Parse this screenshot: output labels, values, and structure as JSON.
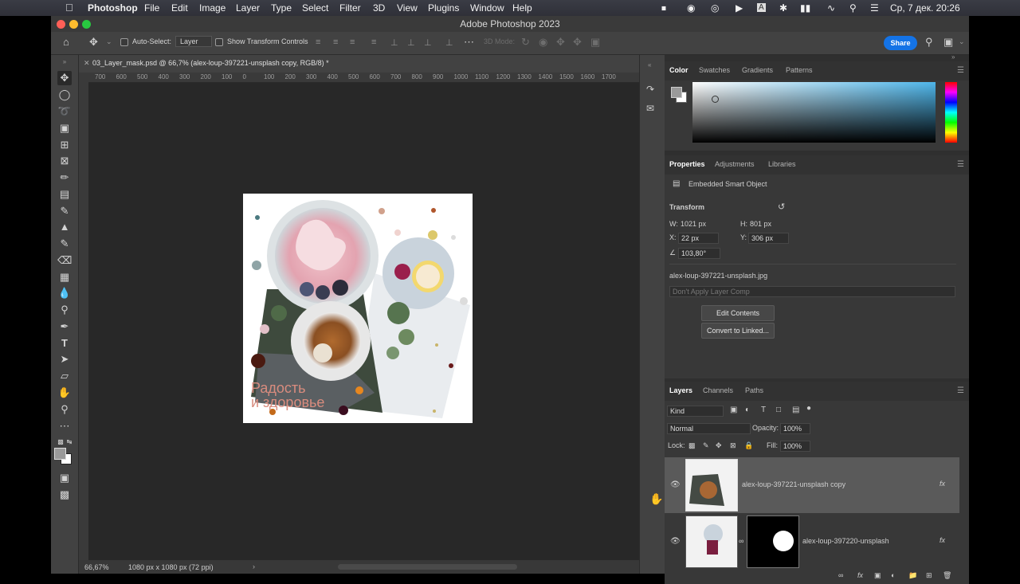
{
  "menubar": {
    "app": "Photoshop",
    "items": [
      "File",
      "Edit",
      "Image",
      "Layer",
      "Type",
      "Select",
      "Filter",
      "3D",
      "View",
      "Plugins",
      "Window",
      "Help"
    ],
    "clock": "Ср, 7 дек.  20:26"
  },
  "window": {
    "title": "Adobe Photoshop 2023"
  },
  "options": {
    "auto_select_label": "Auto-Select:",
    "auto_select_value": "Layer",
    "show_transform": "Show Transform Controls",
    "mode_3d": "3D Mode:",
    "share": "Share"
  },
  "document": {
    "tab_title": "03_Layer_mask.psd @ 66,7% (alex-loup-397221-unsplash copy, RGB/8) *",
    "ruler_ticks": [
      "700",
      "600",
      "500",
      "400",
      "300",
      "200",
      "100",
      "0",
      "100",
      "200",
      "300",
      "400",
      "500",
      "600",
      "700",
      "800",
      "900",
      "1000",
      "1100",
      "1200",
      "1300",
      "1400",
      "1500",
      "1600",
      "1700"
    ],
    "zoom": "66,67%",
    "dimensions": "1080 px x 1080 px (72 ppi)",
    "canvas_text_line1": "Радость",
    "canvas_text_line2": "и здоровье"
  },
  "color_panel": {
    "tabs": [
      "Color",
      "Swatches",
      "Gradients",
      "Patterns"
    ],
    "colors": {
      "fg": "#9a9a9a",
      "bg": "#ffffff",
      "hue": "#4fb6ea"
    }
  },
  "properties_panel": {
    "tabs": [
      "Properties",
      "Adjustments",
      "Libraries"
    ],
    "object_type": "Embedded Smart Object",
    "transform_label": "Transform",
    "w_label": "W:",
    "w_value": "1021 px",
    "h_label": "H:",
    "h_value": "801 px",
    "x_label": "X:",
    "x_value": "22 px",
    "y_label": "Y:",
    "y_value": "306 px",
    "angle_value": "103,80°",
    "filename": "alex-loup-397221-unsplash.jpg",
    "layer_comp": "Don't Apply Layer Comp",
    "edit_contents": "Edit Contents",
    "convert_linked": "Convert to Linked..."
  },
  "layers_panel": {
    "tabs": [
      "Layers",
      "Channels",
      "Paths"
    ],
    "filter_kind": "Kind",
    "blend_mode": "Normal",
    "opacity_label": "Opacity:",
    "opacity_value": "100%",
    "lock_label": "Lock:",
    "fill_label": "Fill:",
    "fill_value": "100%",
    "layers": [
      {
        "name": "alex-loup-397221-unsplash copy",
        "fx": "fx"
      },
      {
        "name": "alex-loup-397220-unsplash",
        "fx": "fx"
      }
    ]
  }
}
